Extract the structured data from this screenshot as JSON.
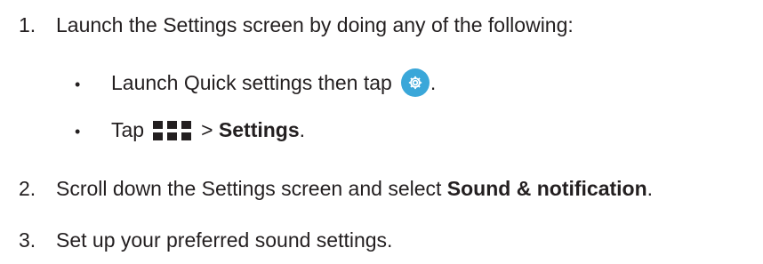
{
  "steps": [
    {
      "number": "1.",
      "text": "Launch the Settings screen by doing any of the following:"
    },
    {
      "number": "2.",
      "text_before": "Scroll down the Settings screen and select ",
      "bold": "Sound & notification",
      "text_after": "."
    },
    {
      "number": "3.",
      "text": "Set up your preferred sound settings."
    }
  ],
  "substeps": [
    {
      "bullet": "•",
      "text_before": "Launch Quick settings then tap",
      "icon": "settings-gear-icon",
      "text_after": "."
    },
    {
      "bullet": "•",
      "text_before": "Tap",
      "icon": "all-apps-grid-icon",
      "separator": ">",
      "bold": "Settings",
      "text_after": "."
    }
  ],
  "colors": {
    "text": "#231f20",
    "settings_icon_bg": "#3aa7d9"
  }
}
